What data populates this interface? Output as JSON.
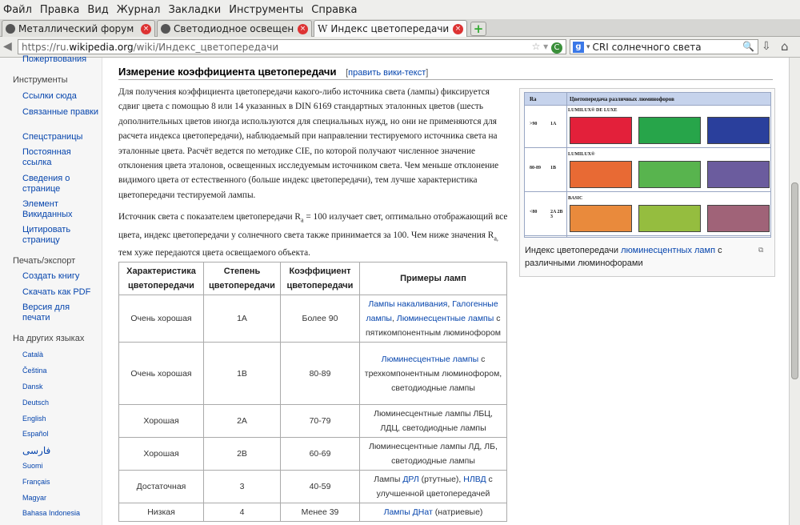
{
  "menu": [
    "Файл",
    "Правка",
    "Вид",
    "Журнал",
    "Закладки",
    "Инструменты",
    "Справка"
  ],
  "tabs": [
    {
      "title": "Металлический форум",
      "active": false
    },
    {
      "title": "Светодиодное освещение ...",
      "active": false
    },
    {
      "title": "Индекс цветопередачи — ...",
      "active": true
    }
  ],
  "tab_close": "×",
  "newtab": "+",
  "nav": {
    "back": "◀",
    "url_prefix": "https://ru.",
    "url_host": "wikipedia.org",
    "url_path": "/wiki/Индекс_цветопередачи",
    "star": "☆",
    "search_engine": "g",
    "search_text": "CRI солнечного света",
    "search_icon": "🔍",
    "download": "⇩",
    "home": "⌂"
  },
  "sidebar": {
    "top_cut": "Пожертвования",
    "tools_heading": "Инструменты",
    "tools": [
      "Ссылки сюда",
      "Связанные правки",
      "Спецстраницы",
      "Постоянная ссылка",
      "Сведения о странице",
      "Элемент Викиданных",
      "Цитировать страницу"
    ],
    "print_heading": "Печать/экспорт",
    "print": [
      "Создать книгу",
      "Скачать как PDF",
      "Версия для печати"
    ],
    "langs_heading": "На других языках",
    "langs": [
      "Català",
      "Čeština",
      "Dansk",
      "Deutsch",
      "English",
      "Español",
      "فارسی",
      "Suomi",
      "Français",
      "Magyar",
      "Bahasa Indonesia"
    ]
  },
  "article": {
    "heading": "Измерение коэффициента цветопередачи",
    "edit": "править вики-текст",
    "para1": "Для получения коэффициента цветопередачи какого-либо источника света (лампы) фиксируется сдвиг цвета с помощью 8 или 14 указанных в DIN 6169 стандартных эталонных цветов (шесть дополнительных цветов иногда используются для специальных нужд, но они не применяются для расчета индекса цветопередачи), наблюдаемый при направлении тестируемого источника света на эталонные цвета. Расчёт ведется по методике CIE, по которой получают численное значение отклонения цвета эталонов, освещенных исследуемым источником света. Чем меньше отклонение видимого цвета от естественного (больше индекс цветопередачи), тем лучше характеристика цветопередачи тестируемой лампы.",
    "para2_a": "Источник света с показателем цветопередачи R",
    "para2_sub": "a",
    "para2_b": " = 100 излучает свет, оптимально отображающий все цвета, индекс цветопередачи у солнечного света также принимается за 100. Чем ниже значения R",
    "para2_sub2": "a,",
    "para2_c": " тем хуже передаются цвета освещаемого объекта."
  },
  "table": {
    "headers": [
      "Характеристика цветопередачи",
      "Степень цветопередачи",
      "Коэффициент цветопередачи",
      "Примеры ламп"
    ],
    "rows": [
      {
        "char": "Очень хорошая",
        "grade": "1A",
        "coef": "Более 90",
        "ex_html": "<span class=\"lk\">Лампы накаливания</span>, <span class=\"lk\">Галогенные лампы</span>, <span class=\"lk\">Люминесцентные лампы</span> с пятикомпонентным люминофором"
      },
      {
        "char": "Очень хорошая",
        "grade": "1B",
        "coef": "80-89",
        "ex_html": "<span class=\"lk\">Люминесцентные лампы</span> с трехкомпонентным люминофором, светодиодные лампы"
      },
      {
        "char": "Хорошая",
        "grade": "2A",
        "coef": "70-79",
        "ex_html": "Люминесцентные лампы ЛБЦ, ЛДЦ, светодиодные лампы"
      },
      {
        "char": "Хорошая",
        "grade": "2B",
        "coef": "60-69",
        "ex_html": "Люминесцентные лампы ЛД, ЛБ, светодиодные лампы"
      },
      {
        "char": "Достаточная",
        "grade": "3",
        "coef": "40-59",
        "ex_html": "Лампы <span class=\"lk\">ДРЛ</span> (ртутные), <span class=\"lk\">НЛВД</span> с улучшенной цветопередачей"
      },
      {
        "char": "Низкая",
        "grade": "4",
        "coef": "Менее 39",
        "ex_html": "<span class=\"lk\">Лампы ДНат</span> (натриевые)"
      }
    ]
  },
  "figure": {
    "head_col1": "Ra",
    "head_col2": "Цветопередача различных люминофоров",
    "rows": [
      {
        "range": ">90",
        "grade": "1A",
        "category": "LUMILUX® DE LUXE",
        "colors": [
          "#e3203a",
          "#27a54a",
          "#2a3f9c"
        ]
      },
      {
        "range": "80-89",
        "grade": "1B",
        "category": "LUMILUX®",
        "colors": [
          "#e86a34",
          "#58b44e",
          "#6b5c9e"
        ]
      },
      {
        "range": "<80",
        "grade": "2A 2B 3",
        "category": "BASIC",
        "colors": [
          "#e98a3c",
          "#95bd3f",
          "#a06378"
        ]
      }
    ],
    "caption_a": "Индекс цветопередачи ",
    "caption_link": "люминесцентных ламп",
    "caption_b": " с различными люминофорами",
    "enlarge": "⧉"
  }
}
